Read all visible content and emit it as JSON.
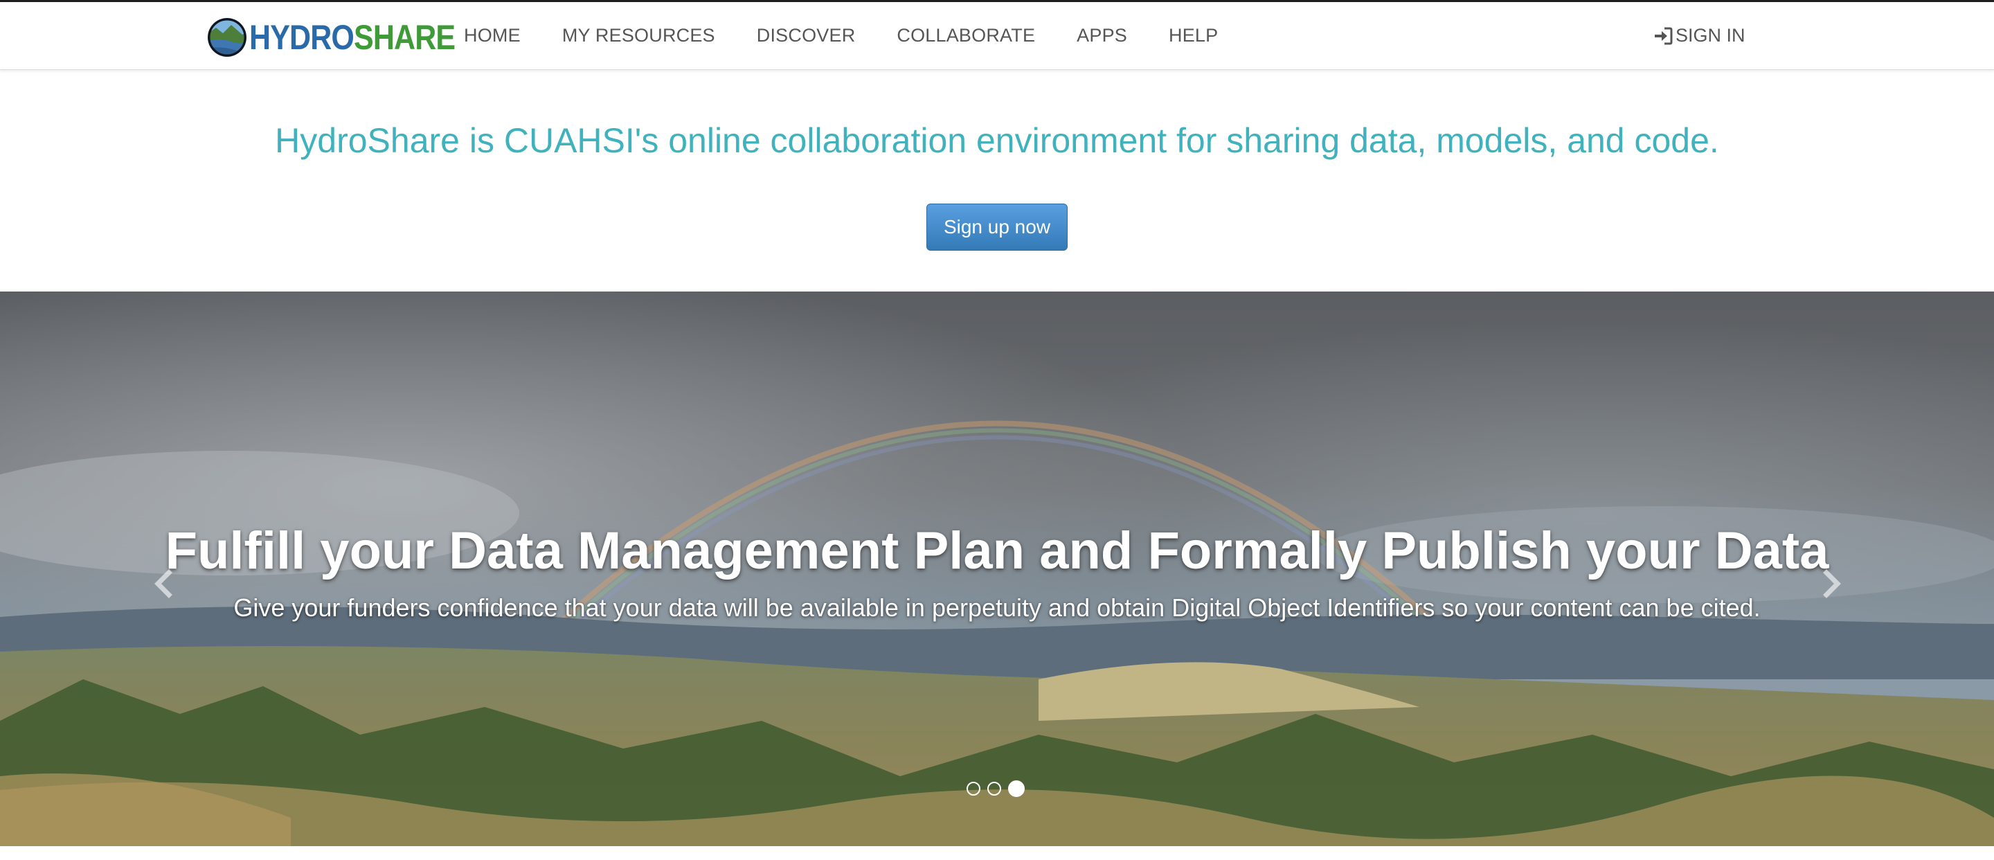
{
  "navbar": {
    "brand": {
      "hydro": "HYDRO",
      "share": "SHARE"
    },
    "links": [
      "HOME",
      "MY RESOURCES",
      "DISCOVER",
      "COLLABORATE",
      "APPS",
      "HELP"
    ],
    "sign_in": "SIGN IN",
    "sign_in_icon": "sign-in-icon"
  },
  "hero": {
    "tagline": "HydroShare is CUAHSI's online collaboration environment for sharing data, models, and code.",
    "signup_button": "Sign up now"
  },
  "carousel": {
    "title": "Fulfill your Data Management Plan and Formally Publish your Data",
    "subtitle": "Give your funders confidence that your data will be available in perpetuity and obtain Digital Object Identifiers so your content can be cited.",
    "indicator_count": 3,
    "active_index": 2,
    "prev_icon": "chevron-left-icon",
    "next_icon": "chevron-right-icon"
  },
  "colors": {
    "tagline": "#3fb2bd",
    "button": "#337ab7",
    "brand_blue": "#2a6aa8",
    "brand_green": "#3f9a38"
  }
}
